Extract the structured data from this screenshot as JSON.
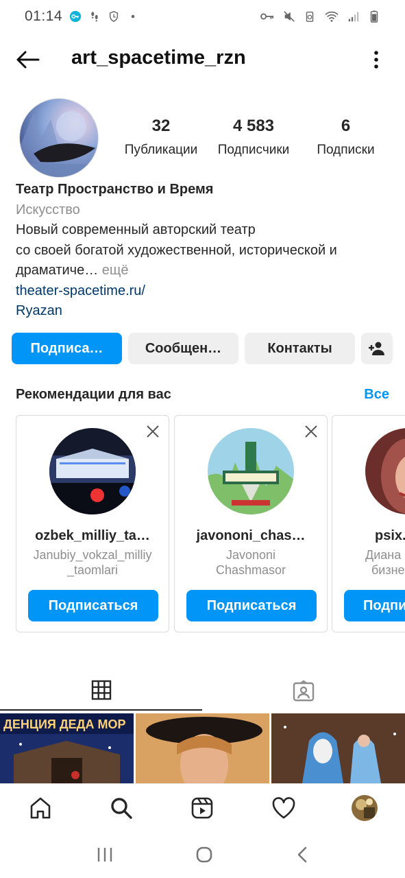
{
  "status_bar": {
    "time": "01:14"
  },
  "header": {
    "username": "art_spacetime_rzn"
  },
  "profile": {
    "stats": [
      {
        "value": "32",
        "label": "Публикации"
      },
      {
        "value": "4 583",
        "label": "Подписчики"
      },
      {
        "value": "6",
        "label": "Подписки"
      }
    ],
    "name": "Театр Пространство и Время",
    "category": "Искусство",
    "bio_line1": "Новый современный авторский театр",
    "bio_line2": "со своей богатой художественной, исторической и",
    "bio_line3": "драматиче…",
    "more_label": " ещё",
    "link": "theater-spacetime.ru/",
    "location": "Ryazan"
  },
  "actions": {
    "follow_label": "Подписа…",
    "message_label": "Сообщен…",
    "contacts_label": "Контакты"
  },
  "suggestions": {
    "title": "Рекомендации для вас",
    "see_all": "Все",
    "cards": [
      {
        "username": "ozbek_milliy_ta…",
        "subtitle_line1": "Janubiy_vokzal_milliy",
        "subtitle_line2": "_taomlari",
        "button": "Подписаться"
      },
      {
        "username": "javononi_chas…",
        "subtitle_line1": "Javononi",
        "subtitle_line2": "Chashmasor",
        "button": "Подписаться"
      },
      {
        "username": "psix.",
        "subtitle_line1": "Диана",
        "subtitle_line2": "бизне",
        "button": "Подпи"
      }
    ]
  },
  "colors": {
    "accent": "#0095f6",
    "link": "#00376b",
    "secondary_text": "#8e8e8e"
  }
}
